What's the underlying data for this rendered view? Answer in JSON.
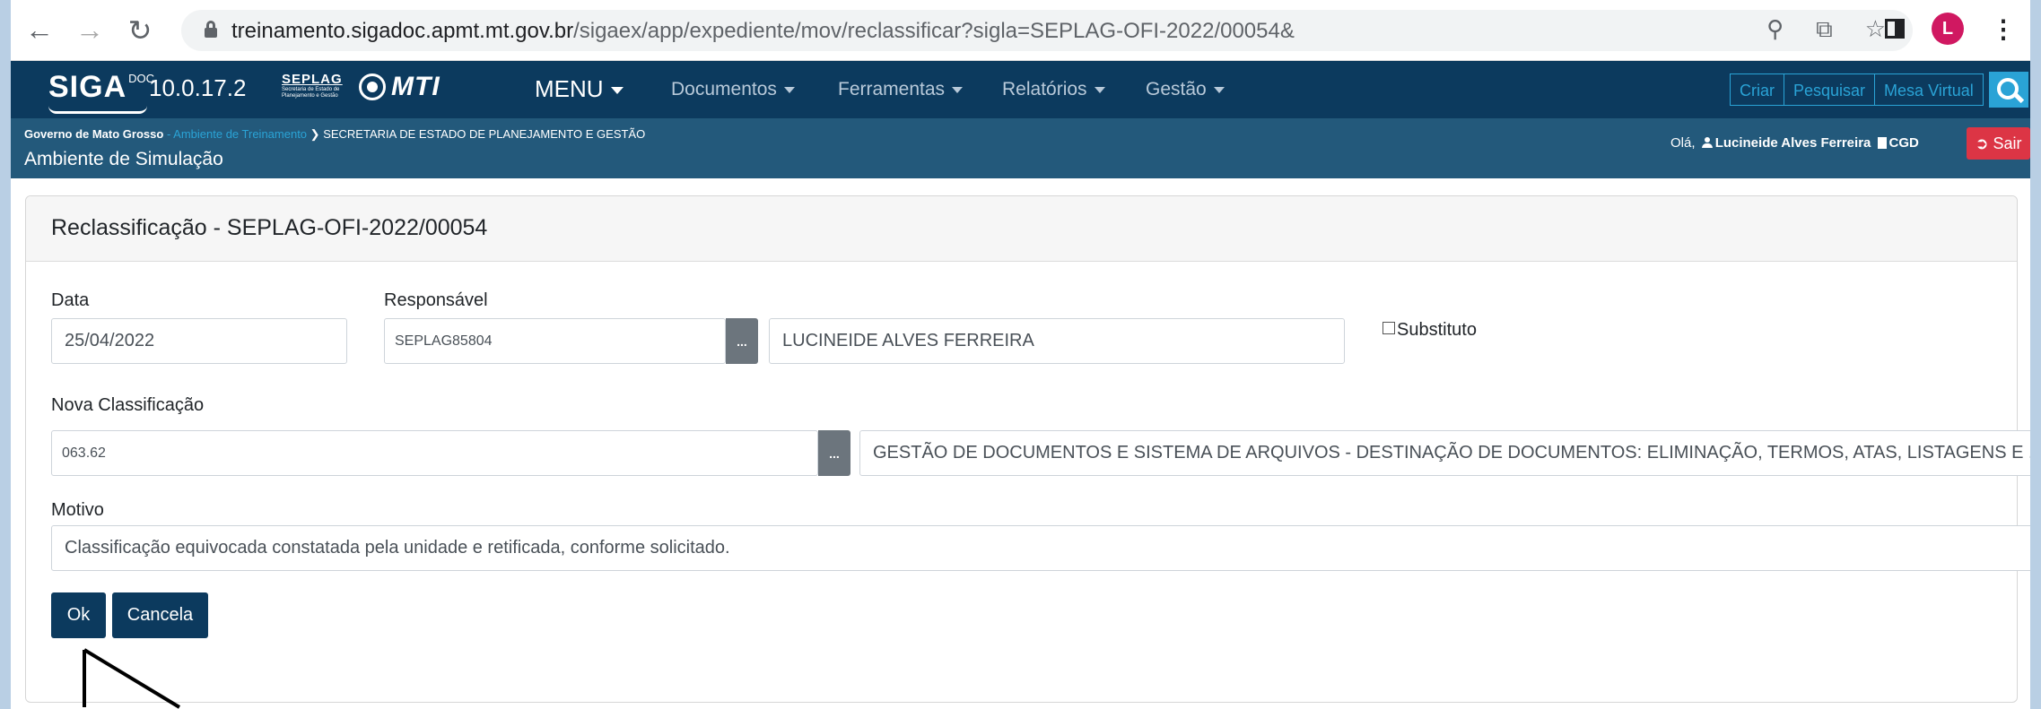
{
  "browser": {
    "url_host": "treinamento.sigadoc.apmt.mt.gov.br",
    "url_path": "/sigaex/app/expediente/mov/reclassificar?sigla=SEPLAG-OFI-2022/00054&",
    "profile_initial": "L"
  },
  "navbar": {
    "brand": "SIGA",
    "brand_sup": "DOC",
    "version": "10.0.17.2",
    "logo_text": "SEPLAG",
    "logo_sub": "Secretaria de Estado de Planejamento e Gestão",
    "mti_logo": "MTI",
    "menu_label": "MENU",
    "items": [
      "Documentos",
      "Ferramentas",
      "Relatórios",
      "Gestão"
    ],
    "right_buttons": [
      "Criar",
      "Pesquisar",
      "Mesa Virtual"
    ]
  },
  "subbar": {
    "gov": "Governo de Mato Grosso",
    "env": "Ambiente de Treinamento",
    "secretaria": "SECRETARIA DE ESTADO DE PLANEJAMENTO E GESTÃO",
    "sim": "Ambiente de Simulação",
    "hello": "Olá,",
    "user": "Lucineide Alves Ferreira",
    "unit": "CGD",
    "logout": "Sair"
  },
  "form": {
    "title": "Reclassificação - SEPLAG-OFI-2022/00054",
    "date_label": "Data",
    "date_value": "25/04/2022",
    "resp_label": "Responsável",
    "resp_code": "SEPLAG85804",
    "resp_name": "LUCINEIDE ALVES FERREIRA",
    "lookup_btn": "...",
    "substituto": "Substituto",
    "class_label": "Nova Classificação",
    "class_code": "063.62",
    "class_desc": "GESTÃO DE DOCUMENTOS E SISTEMA DE ARQUIVOS - DESTINAÇÃO DE DOCUMENTOS: ELIMINAÇÃO, TERMOS, ATAS, LISTAGENS E ...",
    "motivo_label": "Motivo",
    "motivo_value": "Classificação equivocada constatada pela unidade e retificada, conforme solicitado.",
    "ok": "Ok",
    "cancel": "Cancela"
  },
  "colors": {
    "navbar": "#0c3a5e",
    "subbar": "#23597b",
    "accent": "#2aa3d6",
    "danger": "#dc3545"
  }
}
